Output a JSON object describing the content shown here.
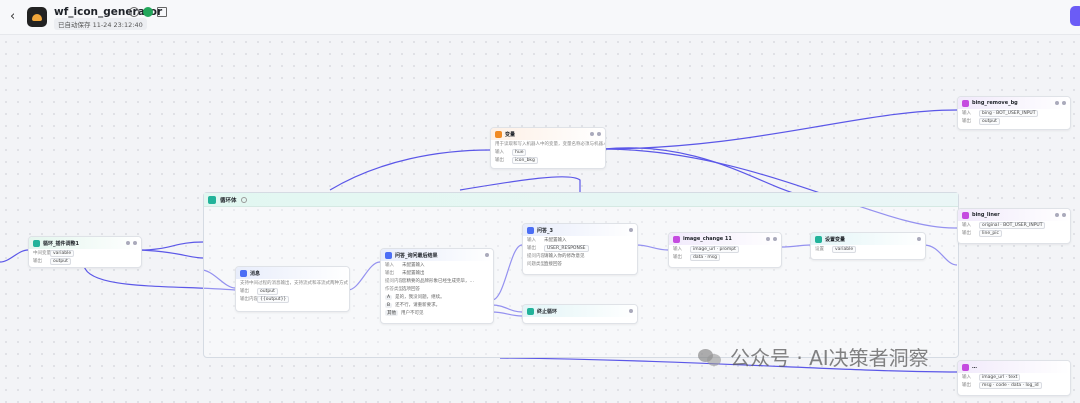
{
  "topbar": {
    "back_label": "‹",
    "app_title": "wf_icon_generator",
    "saved_text": "已自动保存 11-24 23:12:40"
  },
  "loop": {
    "label": "循环体"
  },
  "nodes": {
    "loop_collect": {
      "title": "循环_插件调整1",
      "rows": [
        [
          "中间变量",
          "variable"
        ],
        [
          "输出",
          "output"
        ]
      ]
    },
    "variable": {
      "title": "变量",
      "desc": "用于读取和写入机器人中的变量，变量名称必须与机器人中的…",
      "rows": [
        [
          "输入",
          "hue"
        ],
        [
          "输出",
          "icon_bkg"
        ]
      ]
    },
    "message": {
      "title": "消息",
      "desc": "支持中间过程的消息输出，支持流式和非流式两种方式",
      "rows": [
        [
          "输出",
          "output"
        ]
      ],
      "content_label": "输出内容",
      "content_value": "{{output}}"
    },
    "question_result": {
      "title": "问答_询问最后结果",
      "rows": [
        [
          "输入",
          "未配置输入"
        ],
        [
          "输出",
          "未配置输出"
        ]
      ],
      "content_label": "提问内容",
      "content_value": "您精要的品牌形象已经生成完毕，…",
      "answer_label": "作答类型",
      "answer_value": "选项回答",
      "options": [
        {
          "key": "A",
          "text": "是的，我没问题，继续。"
        },
        {
          "key": "B",
          "text": "还不行，请重新要求。"
        },
        {
          "key": "其他",
          "text": "用户不可见"
        }
      ]
    },
    "question3": {
      "title": "问答_3",
      "rows": [
        [
          "输入",
          "未配置输入"
        ],
        [
          "输出",
          "USER_RESPONSE"
        ]
      ],
      "content_label": "提问内容",
      "content_value": "请输入你的修改意见",
      "answer_label": "问题类型",
      "answer_value": "直接回答"
    },
    "stop_loop": {
      "title": "终止循环"
    },
    "image_change": {
      "title": "image_change 11",
      "rows": [
        [
          "输入",
          "image_url · prompt"
        ],
        [
          "输出",
          "data · msg"
        ]
      ]
    },
    "set_variable": {
      "title": "设置变量",
      "rows": [
        [
          "设置",
          "variable"
        ]
      ]
    },
    "bing_remove_bg": {
      "title": "bing_remove_bg",
      "rows": [
        [
          "输入",
          "bing · BOT_USER_INPUT"
        ],
        [
          "输出",
          "output"
        ]
      ]
    },
    "bing_liner": {
      "title": "bing_liner",
      "rows": [
        [
          "输入",
          "original · BOT_USER_INPUT"
        ],
        [
          "输出",
          "line_pic"
        ]
      ]
    },
    "bottom_node": {
      "title": "…",
      "rows": [
        [
          "输入",
          "image_url · text"
        ],
        [
          "输出",
          "msg · code · data · log_id"
        ]
      ]
    }
  },
  "watermark": {
    "text": "公众号 · AI决策者洞察"
  },
  "colors": {
    "edge": "#5b57e8",
    "accent": "#6b5cf6",
    "loop_green": "#22b39a"
  }
}
